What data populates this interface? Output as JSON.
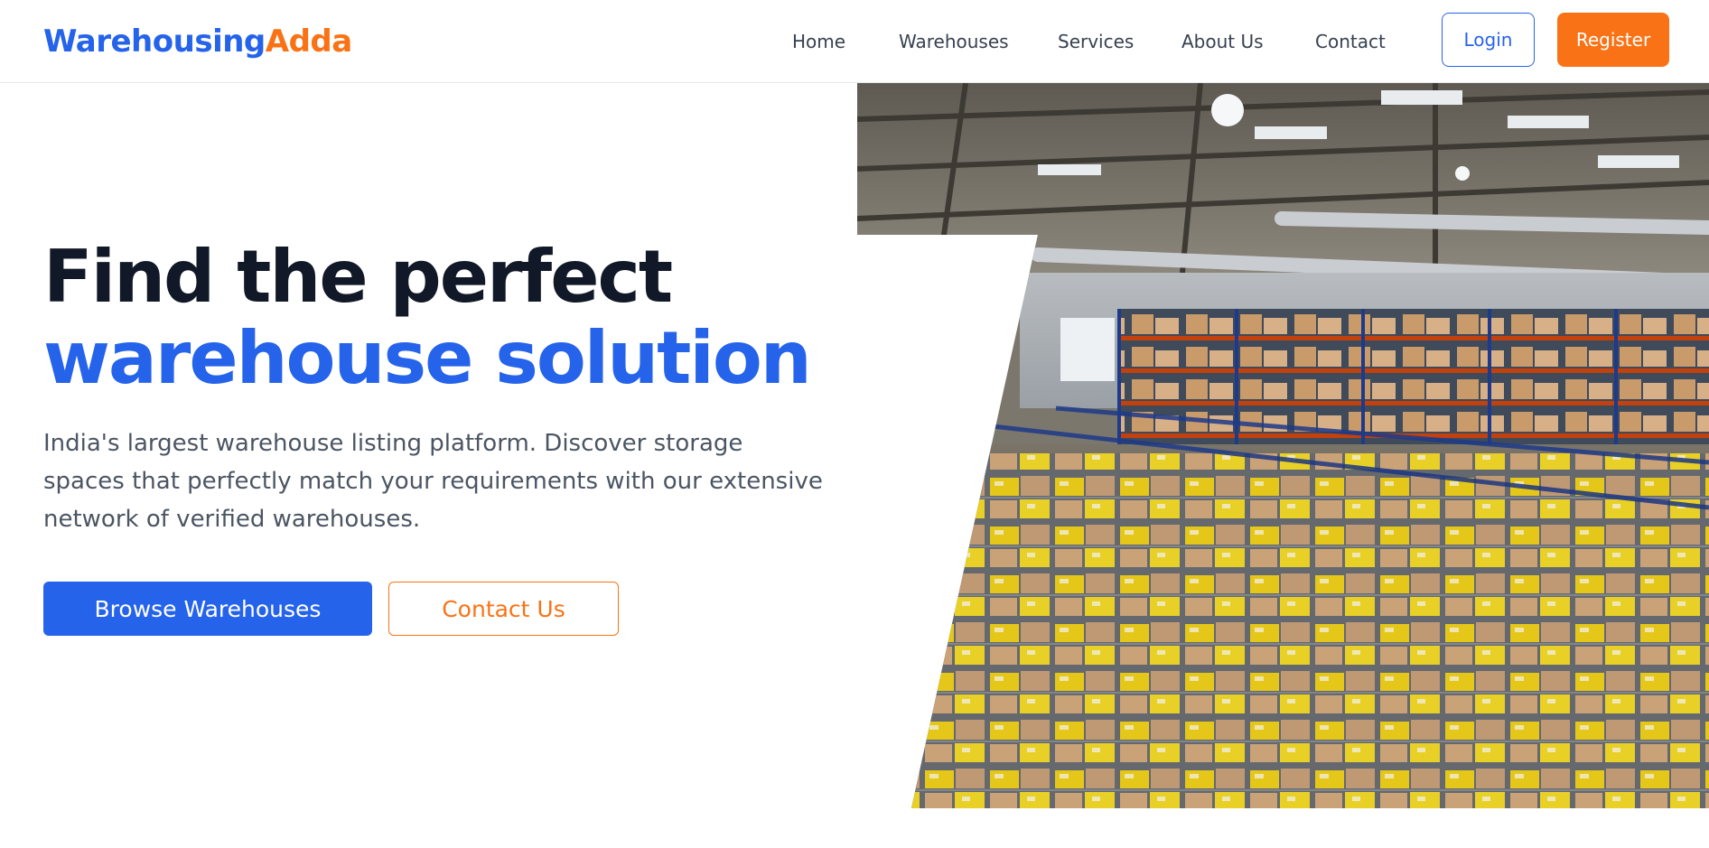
{
  "brand": {
    "part1": "Warehousing",
    "part2": "Adda"
  },
  "nav": {
    "links": [
      "Home",
      "Warehouses",
      "Services",
      "About Us",
      "Contact"
    ],
    "login": "Login",
    "register": "Register"
  },
  "hero": {
    "title_line1": "Find the perfect",
    "title_line2": "warehouse solution",
    "description": "India's largest warehouse listing platform. Discover storage spaces that perfectly match your requirements with our extensive network of verified warehouses.",
    "primary_cta": "Browse Warehouses",
    "secondary_cta": "Contact Us"
  },
  "colors": {
    "primary": "#2563eb",
    "accent": "#f97316",
    "heading": "#111827",
    "body_text": "#4b5563"
  }
}
